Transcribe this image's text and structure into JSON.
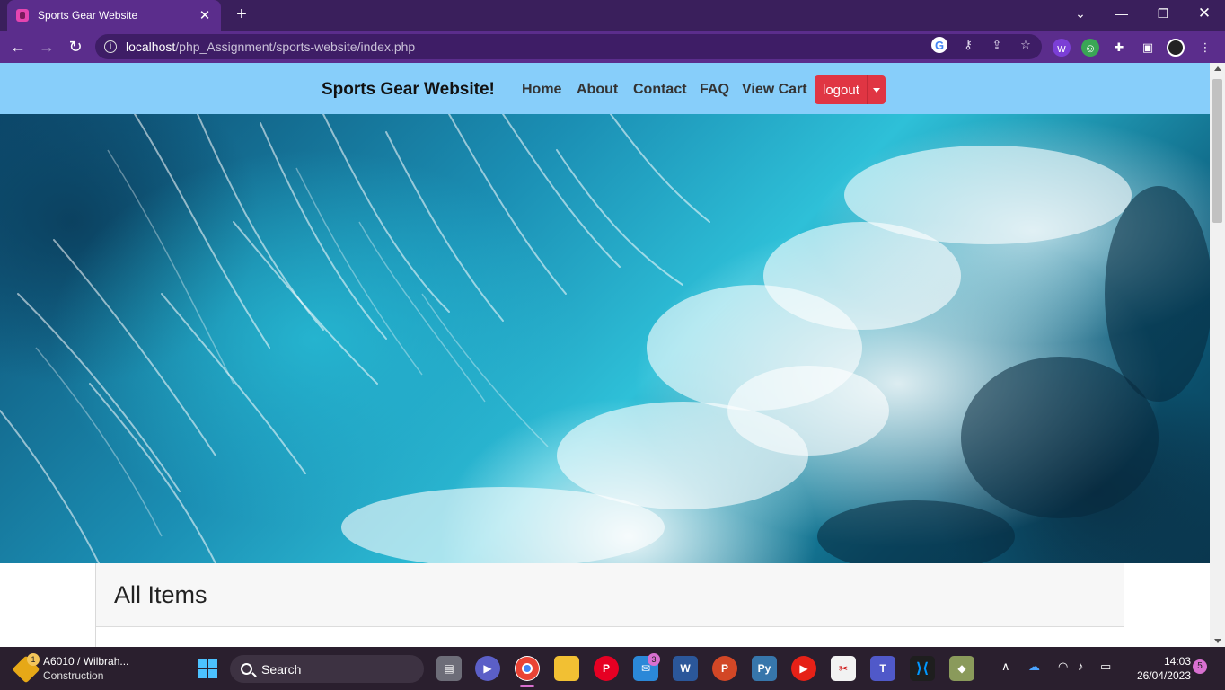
{
  "browser": {
    "tab_title": "Sports Gear Website",
    "url_host": "localhost",
    "url_path": "/php_Assignment/sports-website/index.php"
  },
  "site": {
    "brand": "Sports Gear Website!",
    "nav": [
      "Home",
      "About",
      "Contact",
      "FAQ",
      "View Cart"
    ],
    "logout_label": "logout",
    "section_title": "All Items",
    "nav_color": "#87cefa",
    "logout_color": "#e03543"
  },
  "taskbar": {
    "weather_badge": "1",
    "weather_line1": "A6010 / Wilbrah...",
    "weather_line2": "Construction",
    "search_label": "Search",
    "mail_badge": "3",
    "time": "14:03",
    "date": "26/04/2023",
    "notification_count": "5"
  }
}
